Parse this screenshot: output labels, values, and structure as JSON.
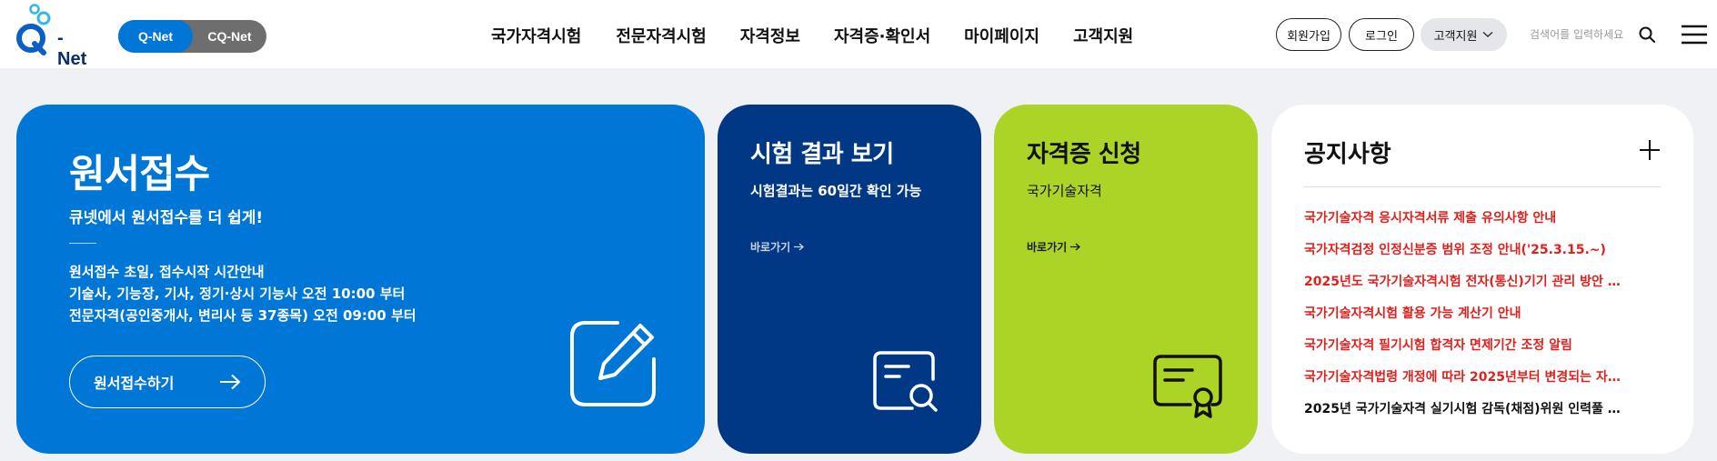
{
  "header": {
    "logo_text": "- Net",
    "toggle": {
      "active": "Q-Net",
      "inactive": "CQ-Net"
    },
    "nav": [
      "국가자격시험",
      "전문자격시험",
      "자격정보",
      "자격증·확인서",
      "마이페이지",
      "고객지원"
    ],
    "signup_label": "회원가입",
    "login_label": "로그인",
    "support_label": "고객지원",
    "search_placeholder": "검색어를 입력하세요"
  },
  "cards": {
    "application": {
      "title": "원서접수",
      "subtitle": "큐넷에서 원서접수를 더 쉽게!",
      "info": [
        "원서접수 초일, 접수시작 시간안내",
        "기술사, 기능장, 기사, 정기·상시 기능사 오전 10:00 부터",
        "전문자격(공인중개사, 변리사 등 37종목) 오전 09:00 부터"
      ],
      "button_label": "원서접수하기"
    },
    "results": {
      "title": "시험 결과 보기",
      "subtitle": "시험결과는 60일간 확인 가능",
      "link_label": "바로가기"
    },
    "certificate": {
      "title": "자격증 신청",
      "subtitle": "국가기술자격",
      "link_label": "바로가기"
    },
    "notices": {
      "title": "공지사항",
      "items": [
        {
          "text": "국가기술자격 응시자격서류 제출 유의사항 안내",
          "highlight": true
        },
        {
          "text": "국가자격검정 인정신분증 범위 조정 안내('25.3.15.~)",
          "highlight": true
        },
        {
          "text": "2025년도 국가기술자격시험 전자(통신)기기 관리 방안 재...",
          "highlight": true
        },
        {
          "text": "국가기술자격시험 활용 가능 계산기 안내",
          "highlight": true
        },
        {
          "text": "국가기술자격 필기시험 합격자 면제기간 조정 알림",
          "highlight": true
        },
        {
          "text": "국가기술자격법령 개정에 따라 2025년부터 변경되는 자격...",
          "highlight": true
        },
        {
          "text": "2025년 국가기술자격 실기시험 감독(채점)위원 인력풀 모...",
          "highlight": false
        }
      ]
    }
  },
  "colors": {
    "primary": "#0076d6",
    "navy": "#003886",
    "lime": "#acd427",
    "notice_red": "#e0201c"
  },
  "icons": [
    "logo-rings-icon",
    "search-icon",
    "menu-icon",
    "arrow-right-icon",
    "edit-icon",
    "document-search-icon",
    "certificate-icon",
    "plus-icon"
  ]
}
